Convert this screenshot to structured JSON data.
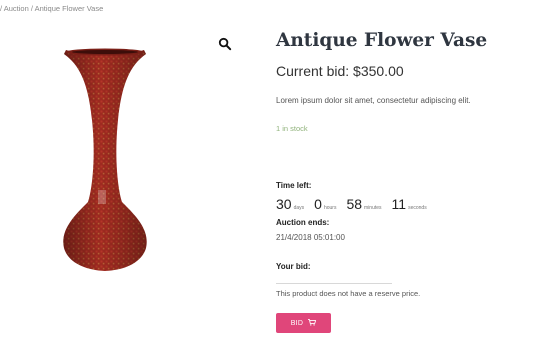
{
  "breadcrumb": {
    "text": "/ Auction / Antique Flower Vase"
  },
  "product": {
    "title": "Antique Flower Vase",
    "current_bid": "Current bid: $350.00",
    "description": "Lorem ipsum dolor sit amet, consectetur adipiscing elit.",
    "stock": "1 in stock",
    "image_alt": "vase-image"
  },
  "auction": {
    "time_left_label": "Time left:",
    "countdown": [
      {
        "value": "30",
        "unit": "days"
      },
      {
        "value": "0",
        "unit": "hours"
      },
      {
        "value": "58",
        "unit": "minutes"
      },
      {
        "value": "11",
        "unit": "seconds"
      }
    ],
    "ends_label": "Auction ends:",
    "ends_value": "21/4/2018 05:01:00",
    "your_bid_label": "Your bid:",
    "bid_value": "",
    "reserve_note": "This product does not have a reserve price.",
    "bid_button_label": "BID"
  },
  "icons": {
    "zoom": "search-icon",
    "bid_button": "cart-icon"
  },
  "colors": {
    "accent": "#e0467a",
    "stock": "#8fb27a",
    "title": "#2f3640"
  }
}
